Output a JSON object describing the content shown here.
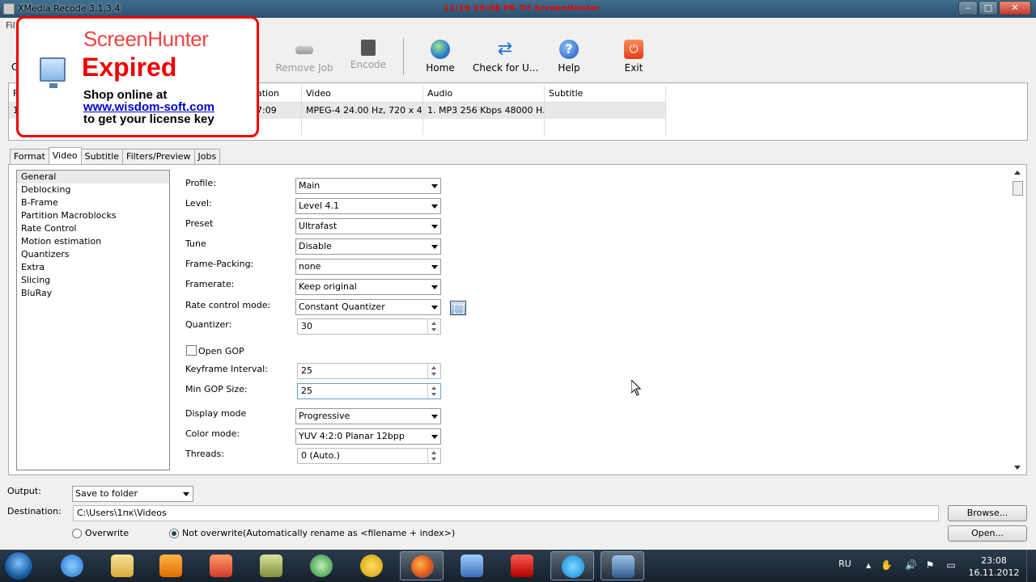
{
  "window": {
    "title": "XMedia Recode 3.1.3.4",
    "stamp": "11/16 23:08 PK Trl ScreenHunter",
    "min_label": "–",
    "max_label": "□",
    "close_label": "✕"
  },
  "menu": {
    "first": "Fil"
  },
  "toolbar": {
    "left_label": "C",
    "items": [
      {
        "label": "Remove Job",
        "icon": "remove-job-icon",
        "enabled": false
      },
      {
        "label": "Encode",
        "icon": "encode-icon",
        "enabled": false
      },
      {
        "label": "Home",
        "icon": "globe-icon",
        "enabled": true
      },
      {
        "label": "Check for U...",
        "icon": "refresh-icon",
        "enabled": true
      },
      {
        "label": "Help",
        "icon": "help-icon",
        "enabled": true
      },
      {
        "label": "Exit",
        "icon": "power-icon",
        "enabled": true
      }
    ]
  },
  "joblist": {
    "headers": [
      "F",
      "ation",
      "Video",
      "Audio",
      "Subtitle"
    ],
    "row": [
      "1",
      "7:09",
      "MPEG-4 24.00 Hz, 720 x 4...",
      "1. MP3 256 Kbps 48000 H...",
      ""
    ]
  },
  "tabs": [
    "Format",
    "Video",
    "Subtitle",
    "Filters/Preview",
    "Jobs"
  ],
  "active_tab": "Video",
  "categories": [
    "General",
    "Deblocking",
    "B-Frame",
    "Partition Macroblocks",
    "Rate Control",
    "Motion estimation",
    "Quantizers",
    "Extra",
    "Slicing",
    "BluRay"
  ],
  "selected_category": "General",
  "settings": {
    "profile": {
      "label": "Profile:",
      "value": "Main"
    },
    "level": {
      "label": "Level:",
      "value": "Level 4.1"
    },
    "preset": {
      "label": "Preset",
      "value": "Ultrafast"
    },
    "tune": {
      "label": "Tune",
      "value": "Disable"
    },
    "frame_packing": {
      "label": "Frame-Packing:",
      "value": "none"
    },
    "framerate": {
      "label": "Framerate:",
      "value": "Keep original"
    },
    "rate_control": {
      "label": "Rate control mode:",
      "value": "Constant Quantizer"
    },
    "quantizer": {
      "label": "Quantizer:",
      "value": "30"
    },
    "open_gop": {
      "label": "Open GOP",
      "checked": false
    },
    "keyframe_interval": {
      "label": "Keyframe Interval:",
      "value": "25"
    },
    "min_gop": {
      "label": "Min GOP Size:",
      "value": "25"
    },
    "display_mode": {
      "label": "Display mode",
      "value": "Progressive"
    },
    "color_mode": {
      "label": "Color mode:",
      "value": "YUV 4:2:0 Planar 12bpp"
    },
    "threads": {
      "label": "Threads:",
      "value": "0 (Auto.)"
    }
  },
  "output": {
    "output_label": "Output:",
    "output_value": "Save to folder",
    "destination_label": "Destination:",
    "destination_value": "C:\\Users\\1пк\\Videos",
    "browse_label": "Browse...",
    "open_label": "Open...",
    "overwrite_label": "Overwrite",
    "not_overwrite_label": "Not overwrite(Automatically rename as <filename + index>)",
    "selected": "not_overwrite"
  },
  "overlay": {
    "brand": "ScreenHunter",
    "status": "Expired",
    "line1": "Shop online at",
    "link": "www.wisdom-soft.com",
    "line3": "to get your license key"
  },
  "taskbar": {
    "language": "RU",
    "time": "23:08",
    "date": "16.11.2012",
    "apps": [
      "ie-icon",
      "folder-icon",
      "media-player-icon",
      "gallery-icon",
      "notes-icon",
      "recycle-icon",
      "norton-icon",
      "firefox-icon",
      "tool-icon",
      "mcafee-icon",
      "skype-icon",
      "xmedia-icon"
    ]
  },
  "colors": {
    "overlay_border": "#e00000",
    "link": "#0000cc",
    "titlebar": "#2a4f6d"
  }
}
